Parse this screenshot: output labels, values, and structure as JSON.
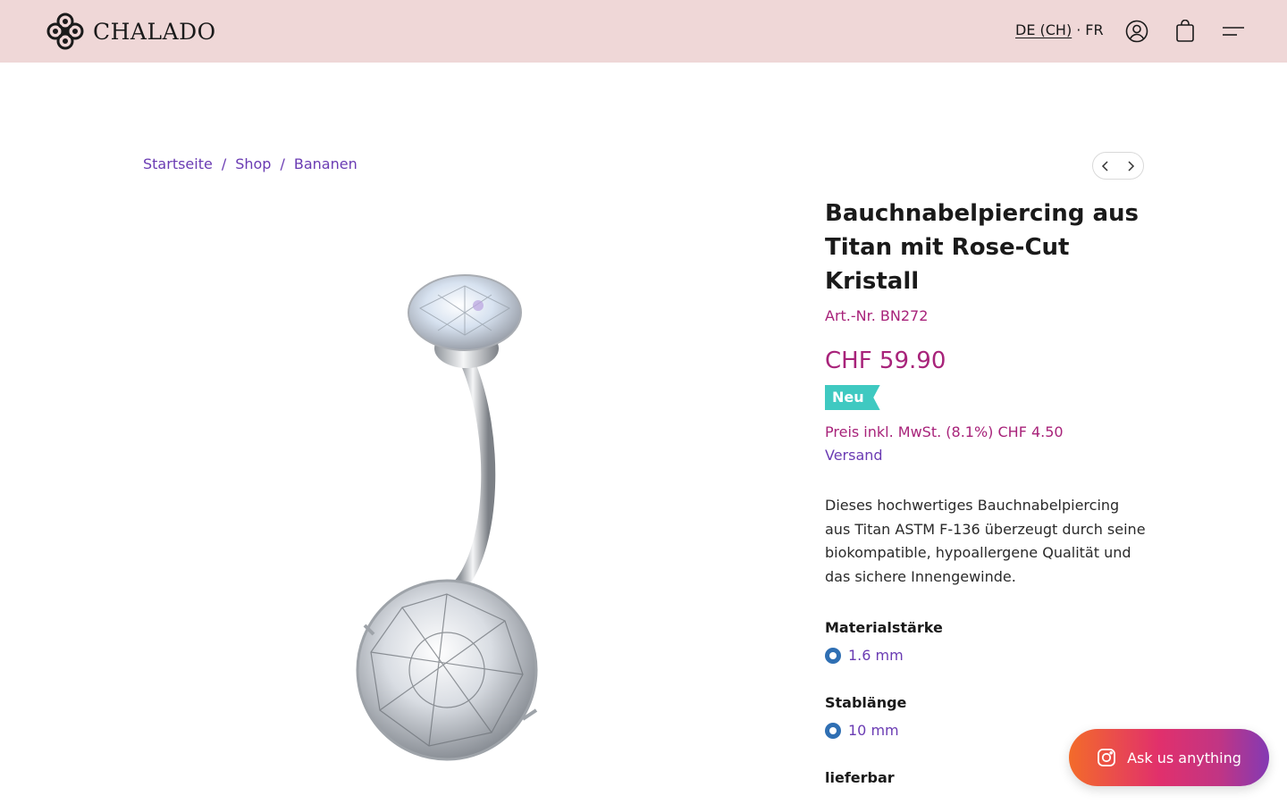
{
  "header": {
    "brand": "CHALADO",
    "lang_de": "DE (CH)",
    "lang_sep": "·",
    "lang_fr": "FR"
  },
  "breadcrumb": {
    "items": [
      "Startseite",
      "Shop",
      "Bananen"
    ],
    "separator": "/"
  },
  "product": {
    "title": "Bauchnabelpiercing aus Titan mit Rose-Cut Kristall",
    "sku": "Art.-Nr. BN272",
    "price": "CHF 59.90",
    "badge": "Neu",
    "tax_note": "Preis inkl. MwSt. (8.1%) CHF 4.50",
    "shipping": "Versand",
    "description": "Dieses hochwertiges Bauchnabelpiercing aus Titan ASTM F-136 überzeugt durch seine biokompatible, hypoallergene Qualität und das sichere Innengewinde.",
    "options": [
      {
        "label": "Materialstärke",
        "value": "1.6 mm"
      },
      {
        "label": "Stablänge",
        "value": "10 mm"
      }
    ],
    "availability": "lieferbar"
  },
  "chat": {
    "label": "Ask us anything"
  },
  "icons": {
    "account": "user-circle-icon",
    "cart": "shopping-bag-icon",
    "menu": "hamburger-menu-icon",
    "prev": "chevron-left-icon",
    "next": "chevron-right-icon",
    "chat": "instagram-icon"
  },
  "colors": {
    "header_bg": "#efd7d7",
    "accent_magenta": "#a8237a",
    "link_purple": "#6a3bb3",
    "badge_teal": "#3fc9c1",
    "radio_blue": "#2f6fb3"
  }
}
